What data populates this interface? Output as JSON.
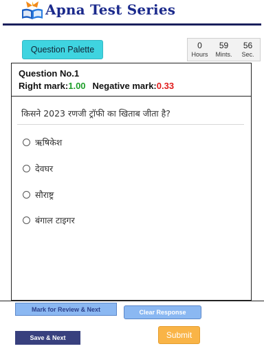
{
  "header": {
    "brand": "Apna Test Series",
    "logo_icon": "open-book-logo-icon"
  },
  "palette_button": "Question Palette",
  "timer": {
    "hours": "0",
    "minutes": "59",
    "seconds": "56",
    "hours_label": "Hours",
    "minutes_label": "Mints.",
    "seconds_label": "Sec."
  },
  "question": {
    "number_label": "Question No.1",
    "right_mark_label": "Right mark:",
    "right_mark_value": "1.00",
    "negative_mark_label": "Negative mark:",
    "negative_mark_value": "0.33",
    "text": "किसने 2023 रणजी ट्रॉफी का खिताब जीता है?",
    "options": [
      {
        "label": "ऋषिकेश",
        "selected": false
      },
      {
        "label": "देवघर",
        "selected": false
      },
      {
        "label": "सौराष्ट्र",
        "selected": false
      },
      {
        "label": "बंगाल टाइगर",
        "selected": false
      }
    ]
  },
  "actions": {
    "mark_review": "Mark for Review & Next",
    "clear_response": "Clear Response",
    "save_next": "Save & Next",
    "submit": "Submit"
  },
  "colors": {
    "brand": "#1b2a8c",
    "palette_button": "#3fd4e0",
    "right_mark": "#1e9e2a",
    "negative_mark": "#e01b1b",
    "review_button": "#8bb8f2",
    "save_button": "#38407e",
    "submit_button": "#f9b447"
  }
}
